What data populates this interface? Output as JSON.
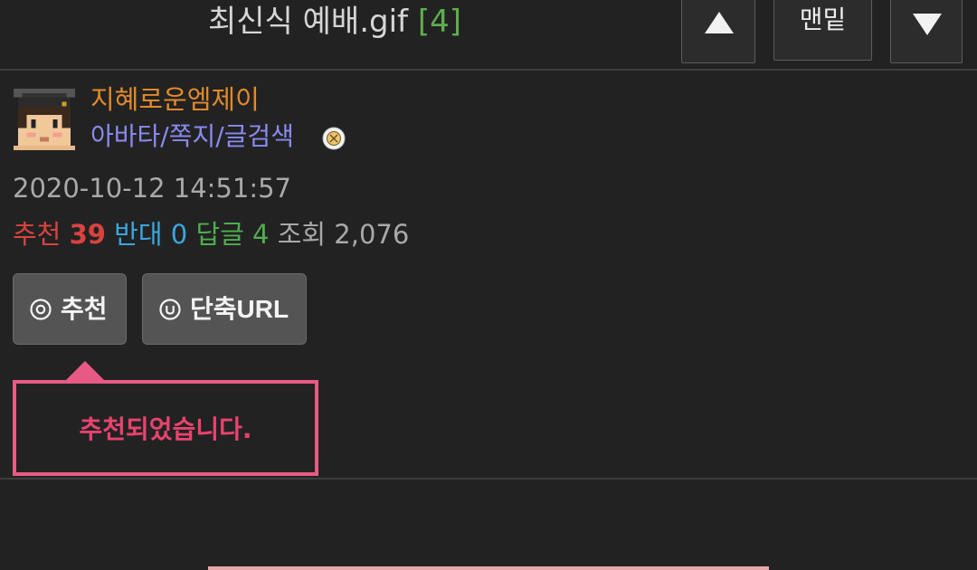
{
  "header": {
    "title": "최신식 예배.gif",
    "comment_count": "[4]",
    "bottom_label": "맨밑",
    "up_icon": "triangle-up-icon",
    "down_icon": "triangle-down-icon"
  },
  "author": {
    "name": "지혜로운엠제이",
    "links": "아바타/쪽지/글검색",
    "badge_icon": "level-badge-icon"
  },
  "post": {
    "date": "2020-10-12 14:51:57",
    "stats": {
      "recommend_label": "추천",
      "recommend_value": "39",
      "oppose_label": "반대",
      "oppose_value": "0",
      "reply_label": "답글",
      "reply_value": "4",
      "view_label": "조회",
      "view_value": "2,076"
    }
  },
  "actions": {
    "recommend_label": "추천",
    "shorturl_label": "단축URL"
  },
  "tooltip": {
    "message": "추천되었습니다."
  },
  "colors": {
    "background": "#222222",
    "author": "#e08a2a",
    "links": "#8a8af0",
    "recommend": "#d9433f",
    "oppose": "#3aa6e0",
    "reply": "#4fae4f",
    "tooltip_border": "#e85a86",
    "tooltip_text": "#e8436f"
  }
}
